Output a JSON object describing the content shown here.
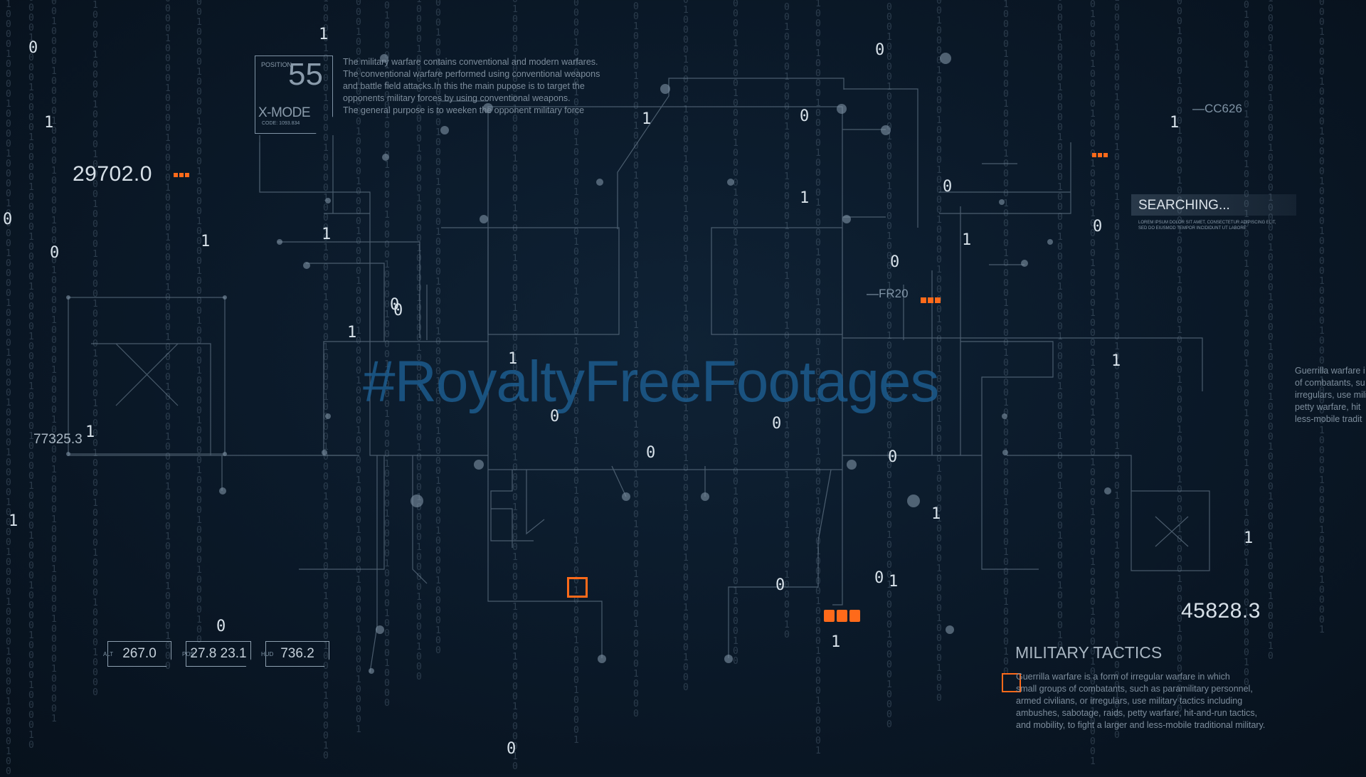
{
  "watermark": "#RoyaltyFreeFootages",
  "position_panel": {
    "label": "POSITION",
    "value": "55",
    "mode": "X-MODE",
    "code": "CODE: 1093.834"
  },
  "warfare_text": [
    "The military warfare contains conventional and modern warfares.",
    "The conventional warfare performed using conventional weapons",
    "and battle field attacks.In this the main pupose is to target the",
    "opponents military forces by using conventional weapons.",
    "The general purpose is to weeken the opponent military force"
  ],
  "readouts": {
    "left_value": "29702.0",
    "left_box_value": "77325.3",
    "right_value": "45828.3",
    "cc_tag": "—CC626",
    "fr_tag": "—FR20"
  },
  "bottom_boxes": [
    {
      "caption": "ALT",
      "value": "267.0"
    },
    {
      "caption": "POS",
      "value": "27.8 23.1"
    },
    {
      "caption": "HUD",
      "value": "736.2"
    }
  ],
  "searching": {
    "label": "SEARCHING...",
    "sub1": "LOREM IPSUM DOLOR SIT AMET, CONSECTETUR ADIPISCING ELIT,",
    "sub2": "SED DO EIUSMOD TEMPOR INCIDIDUNT UT LABORE"
  },
  "guerrilla_side_text": [
    "Guerrilla warfare i",
    "of combatants, su",
    "irregulars, use mili",
    "petty warfare, hit",
    "less-mobile tradit"
  ],
  "military_tactics": {
    "title": "MILITARY TACTICS",
    "lines": [
      "Guerrilla warfare is a form of irregular warfare in which",
      "small groups of combatants, such as paramilitary personnel,",
      "armed civilians, or irregulars, use military tactics including",
      "ambushes, sabotage, raids, petty warfare, hit-and-run tactics,",
      "and mobility, to fight a larger and less-mobile traditional military."
    ]
  },
  "rain_glyphs": [
    "1",
    "0",
    "1",
    "0",
    "0",
    "1",
    "1",
    "0",
    "1",
    "1",
    "0",
    "1",
    "0",
    "0",
    "1",
    "0",
    "1",
    "0",
    "0",
    "1",
    "1",
    "0",
    "0",
    "1",
    "0",
    "1",
    "1",
    "0",
    "0",
    "1"
  ],
  "colors": {
    "background": "#0b1a2a",
    "line": "#7f93a5",
    "accent": "#ff6a1a",
    "watermark": "#1d5f93"
  }
}
